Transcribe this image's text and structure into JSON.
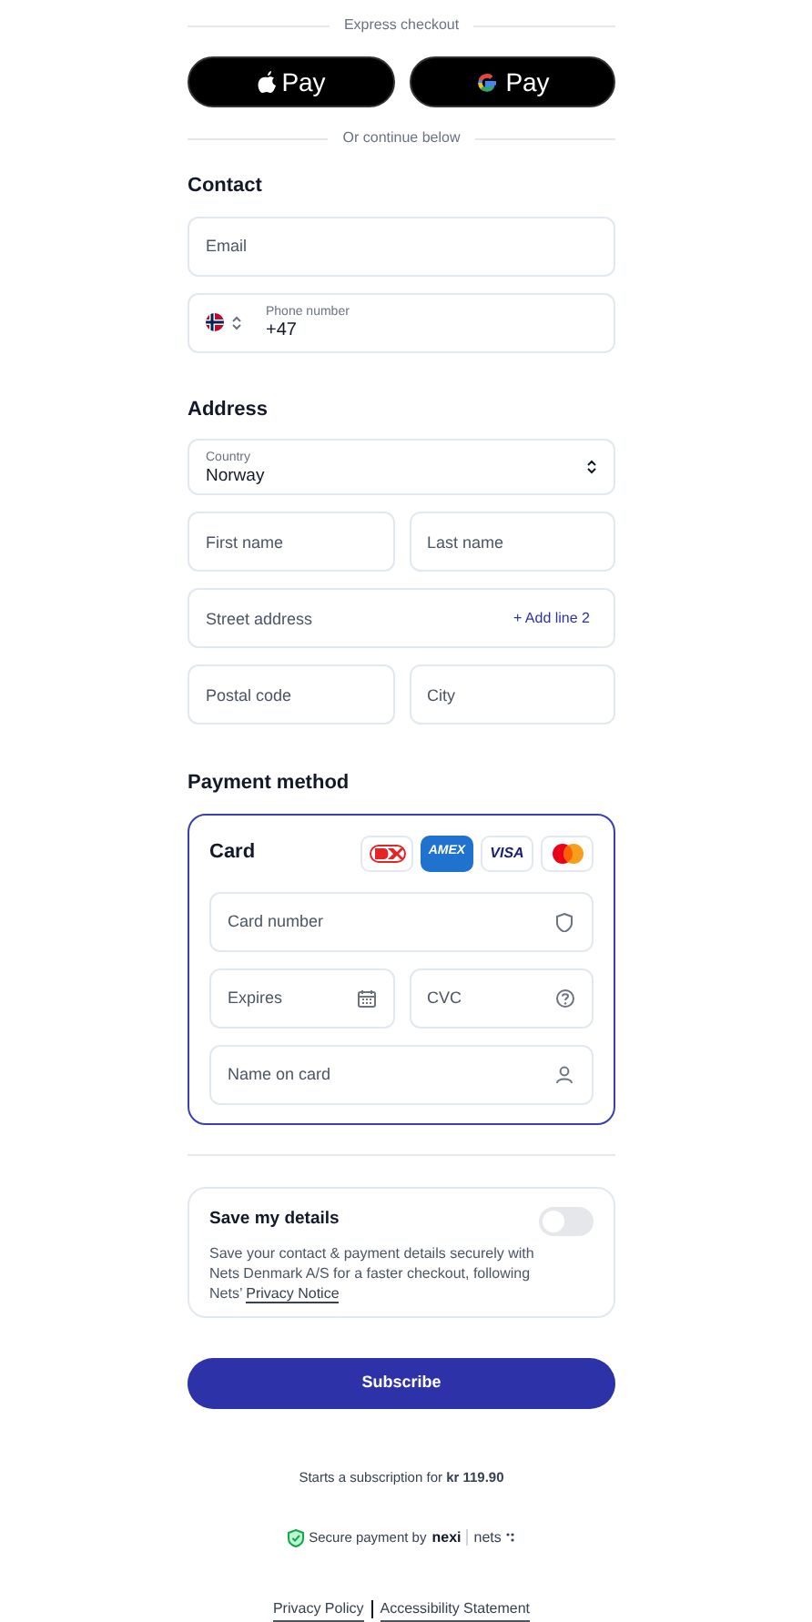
{
  "express": {
    "label": "Express checkout",
    "buttons": [
      {
        "kind": "apple",
        "label": "Pay"
      },
      {
        "kind": "google",
        "label": "Pay"
      }
    ]
  },
  "continue_label": "Or continue below",
  "contact": {
    "heading": "Contact",
    "email": {
      "placeholder": "Email"
    },
    "phone": {
      "label": "Phone number",
      "value": "+47"
    }
  },
  "address": {
    "heading": "Address",
    "country": {
      "label": "Country",
      "value": "Norway"
    },
    "rows": [
      [
        {
          "placeholder": "First name"
        },
        {
          "placeholder": "Last name"
        }
      ],
      [
        {
          "placeholder": "Street address",
          "action": "+ Add line 2"
        }
      ],
      [
        {
          "placeholder": "Postal code"
        },
        {
          "placeholder": "City"
        }
      ]
    ]
  },
  "payment": {
    "heading": "Payment method",
    "card": {
      "title": "Card",
      "selected": true,
      "brands": [
        {
          "kind": "dankort"
        },
        {
          "kind": "amex",
          "label": "AMEX"
        },
        {
          "kind": "visa",
          "label": "VISA"
        },
        {
          "kind": "mastercard"
        }
      ],
      "rows": [
        [
          {
            "placeholder": "Card number",
            "kind": "shield"
          }
        ],
        [
          {
            "placeholder": "Expires",
            "kind": "calendar"
          },
          {
            "placeholder": "CVC",
            "kind": "help"
          }
        ],
        [
          {
            "placeholder": "Name on card",
            "kind": "user"
          }
        ]
      ]
    }
  },
  "save": {
    "title": "Save my details",
    "on": false,
    "text": "Save your contact & payment details securely with Nets Denmark A/S for a faster checkout, following Nets’",
    "link": "Privacy Notice"
  },
  "subscribe": {
    "label": "Subscribe"
  },
  "subscription_note": "Starts a subscription for **kr 119.90**",
  "secure": {
    "text": "Secure payment by",
    "brands": [
      "nexi",
      "nets"
    ]
  },
  "footer_links": [
    "Privacy Policy",
    "Accessibility Statement"
  ]
}
